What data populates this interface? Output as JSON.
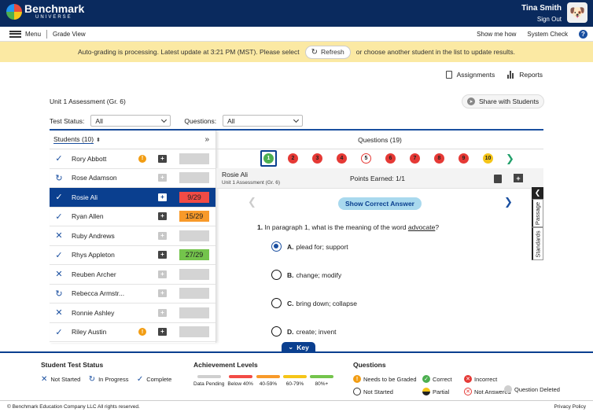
{
  "header": {
    "logo_text": "Benchmark",
    "logo_sub": "UNIVERSE",
    "user_name": "Tina Smith",
    "sign_out": "Sign Out"
  },
  "nav": {
    "menu": "Menu",
    "grade_view": "Grade View",
    "show_me_how": "Show me how",
    "system_check": "System Check",
    "help": "?"
  },
  "banner": {
    "text_before": "Auto-grading is processing. Latest update at 3:21 PM (MST). Please select",
    "refresh": "Refresh",
    "text_after": "or choose another student in the list to update results."
  },
  "actions": {
    "assignments": "Assignments",
    "reports": "Reports",
    "share": "Share with Students"
  },
  "assessment_title": "Unit 1 Assessment (Gr. 6)",
  "filters": {
    "test_status_label": "Test Status:",
    "test_status_value": "All",
    "questions_label": "Questions:",
    "questions_value": "All"
  },
  "students": {
    "label": "Students",
    "count": "(10)",
    "rows": [
      {
        "name": "Rory Abbott",
        "status": "complete",
        "warn": true,
        "note": true,
        "score": ""
      },
      {
        "name": "Rose Adamson",
        "status": "in-progress",
        "warn": false,
        "note": false,
        "score": ""
      },
      {
        "name": "Rosie Ali",
        "status": "complete",
        "warn": false,
        "note": true,
        "score": "9/29",
        "score_color": "#f24b45"
      },
      {
        "name": "Ryan Allen",
        "status": "complete",
        "warn": false,
        "note": true,
        "score": "15/29",
        "score_color": "#f89a2a"
      },
      {
        "name": "Ruby Andrews",
        "status": "not-started",
        "warn": false,
        "note": false,
        "score": ""
      },
      {
        "name": "Rhys Appleton",
        "status": "complete",
        "warn": false,
        "note": true,
        "score": "27/29",
        "score_color": "#74c44c"
      },
      {
        "name": "Reuben Archer",
        "status": "not-started",
        "warn": false,
        "note": false,
        "score": ""
      },
      {
        "name": "Rebecca Armstr...",
        "status": "in-progress",
        "warn": false,
        "note": false,
        "score": ""
      },
      {
        "name": "Ronnie Ashley",
        "status": "not-started",
        "warn": false,
        "note": false,
        "score": ""
      },
      {
        "name": "Riley Austin",
        "status": "complete",
        "warn": true,
        "note": true,
        "score": ""
      }
    ]
  },
  "questions": {
    "label": "Questions",
    "count": "(19)",
    "numbers": [
      {
        "n": "1",
        "state": "correct"
      },
      {
        "n": "2",
        "state": "incorrect"
      },
      {
        "n": "3",
        "state": "incorrect"
      },
      {
        "n": "4",
        "state": "incorrect"
      },
      {
        "n": "5",
        "state": "not-answered"
      },
      {
        "n": "6",
        "state": "incorrect"
      },
      {
        "n": "7",
        "state": "incorrect"
      },
      {
        "n": "8",
        "state": "incorrect"
      },
      {
        "n": "9",
        "state": "incorrect"
      },
      {
        "n": "10",
        "state": "partial"
      }
    ],
    "selected_student": "Rosie Ali",
    "selected_sub": "Unit 1 Assessment (Gr. 6)",
    "points": "Points Earned: 1/1",
    "show_answer": "Show Correct Answer",
    "question_num": "1.",
    "question_before": "In paragraph 1, what is the meaning of the word",
    "question_word": "advocate",
    "question_after": "?",
    "options": [
      {
        "letter": "A.",
        "text": "plead for; support",
        "checked": true
      },
      {
        "letter": "B.",
        "text": "change; modify",
        "checked": false
      },
      {
        "letter": "C.",
        "text": "bring down; collapse",
        "checked": false
      },
      {
        "letter": "D.",
        "text": "create; invent",
        "checked": false
      }
    ],
    "key_btn": "Key"
  },
  "side_tabs": {
    "passage": "Passage",
    "standards": "Standards"
  },
  "key": {
    "status_title": "Student Test Status",
    "not_started": "Not Started",
    "in_progress": "In Progress",
    "complete": "Complete",
    "levels_title": "Achievement Levels",
    "levels": [
      {
        "label": "Data Pending",
        "color": "#cfcfcf"
      },
      {
        "label": "Below 40%",
        "color": "#f24b45"
      },
      {
        "label": "40-59%",
        "color": "#f89a2a"
      },
      {
        "label": "60-79%",
        "color": "#f5c518"
      },
      {
        "label": "80%+",
        "color": "#74c44c"
      }
    ],
    "q_title": "Questions",
    "needs_graded": "Needs to be Graded",
    "correct": "Correct",
    "incorrect": "Incorrect",
    "partial": "Partial",
    "not_answered": "Not Answered",
    "deleted": "Question Deleted"
  },
  "footer": {
    "copyright": "© Benchmark Education Company LLC All rights reserved.",
    "privacy": "Privacy Policy"
  }
}
